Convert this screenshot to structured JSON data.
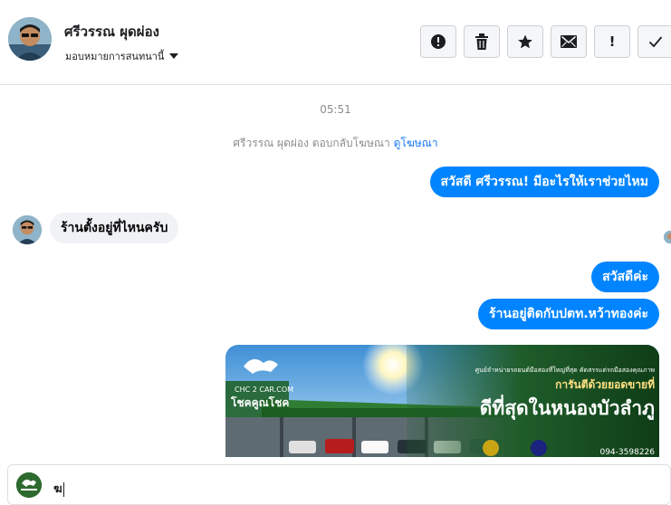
{
  "header": {
    "contact_name": "ศรีวรรณ ผุดผ่อง",
    "assign_label": "มอบหมายการสนทนานี้",
    "toolbar": [
      {
        "name": "spam-button",
        "icon": "alert-circle-icon",
        "label": ""
      },
      {
        "name": "delete-button",
        "icon": "trash-icon",
        "label": ""
      },
      {
        "name": "star-button",
        "icon": "star-icon",
        "label": ""
      },
      {
        "name": "mark-unread-button",
        "icon": "envelope-icon",
        "label": ""
      },
      {
        "name": "follow-up-button",
        "icon": "exclamation-icon",
        "label": "!"
      },
      {
        "name": "done-button",
        "icon": "check-icon",
        "label": ""
      }
    ]
  },
  "thread": {
    "timestamp": "05:51",
    "ad_reply_text": "ศรีวรรณ ผุดผ่อง ตอบกลับโฆษณา",
    "ad_link": "ดูโฆษณา",
    "messages": [
      {
        "direction": "out",
        "text": "สวัสดี ศรีวรรณ! มีอะไรให้เราช่วยไหม"
      },
      {
        "direction": "in",
        "text": "ร้านตั้งอยู่ที่ไหนครับ"
      },
      {
        "direction": "out",
        "text": "สวัสดีค่ะ"
      },
      {
        "direction": "out",
        "text": "ร้านอยู่ติดกับปตท.หว้าทองค่ะ"
      }
    ],
    "ad_image": {
      "brand": "CHC 2 CAR.COM",
      "tagline": "โชคคูณโชค",
      "headline_small": "ศูนย์จำหน่ายรถยนต์มือสองที่ใหญ่ที่สุด คัดสรรแต่รถมือสองคุณภาพ",
      "headline_mid": "การันตีด้วยยอดขายที่",
      "headline_big": "ดีที่สุดในหนองบัวลำภู",
      "phone": "094-3598226"
    }
  },
  "composer": {
    "value": "ฆ"
  },
  "colors": {
    "accent": "#0084ff",
    "link": "#1877f2",
    "incoming_bubble": "#f0f2f5"
  }
}
